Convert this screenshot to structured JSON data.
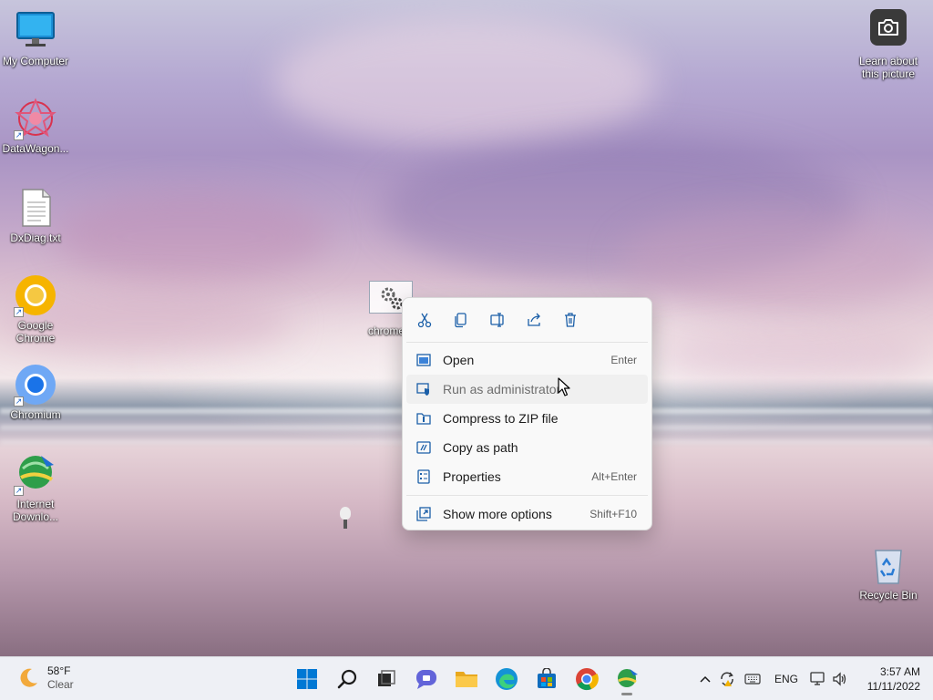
{
  "desktop": {
    "icons": [
      {
        "label": "My Computer"
      },
      {
        "label": "DataWagon..."
      },
      {
        "label": "DxDiag.txt"
      },
      {
        "label": "Google Chrome"
      },
      {
        "label": "Chromium"
      },
      {
        "label": "Internet Downlo..."
      },
      {
        "label": "chrome..."
      },
      {
        "label": "Learn about this picture"
      },
      {
        "label": "Recycle Bin"
      }
    ]
  },
  "context_menu": {
    "items": [
      {
        "label": "Open",
        "shortcut": "Enter"
      },
      {
        "label": "Run as administrator",
        "shortcut": ""
      },
      {
        "label": "Compress to ZIP file",
        "shortcut": ""
      },
      {
        "label": "Copy as path",
        "shortcut": ""
      },
      {
        "label": "Properties",
        "shortcut": "Alt+Enter"
      },
      {
        "label": "Show more options",
        "shortcut": "Shift+F10"
      }
    ]
  },
  "taskbar": {
    "weather": {
      "temp": "58°F",
      "condition": "Clear"
    },
    "language": "ENG",
    "time": "3:57 AM",
    "date": "11/11/2022"
  },
  "colors": {
    "accent": "#0067c0",
    "taskbar_bg": "#eef0f5",
    "menu_bg": "#f9f9f9"
  }
}
